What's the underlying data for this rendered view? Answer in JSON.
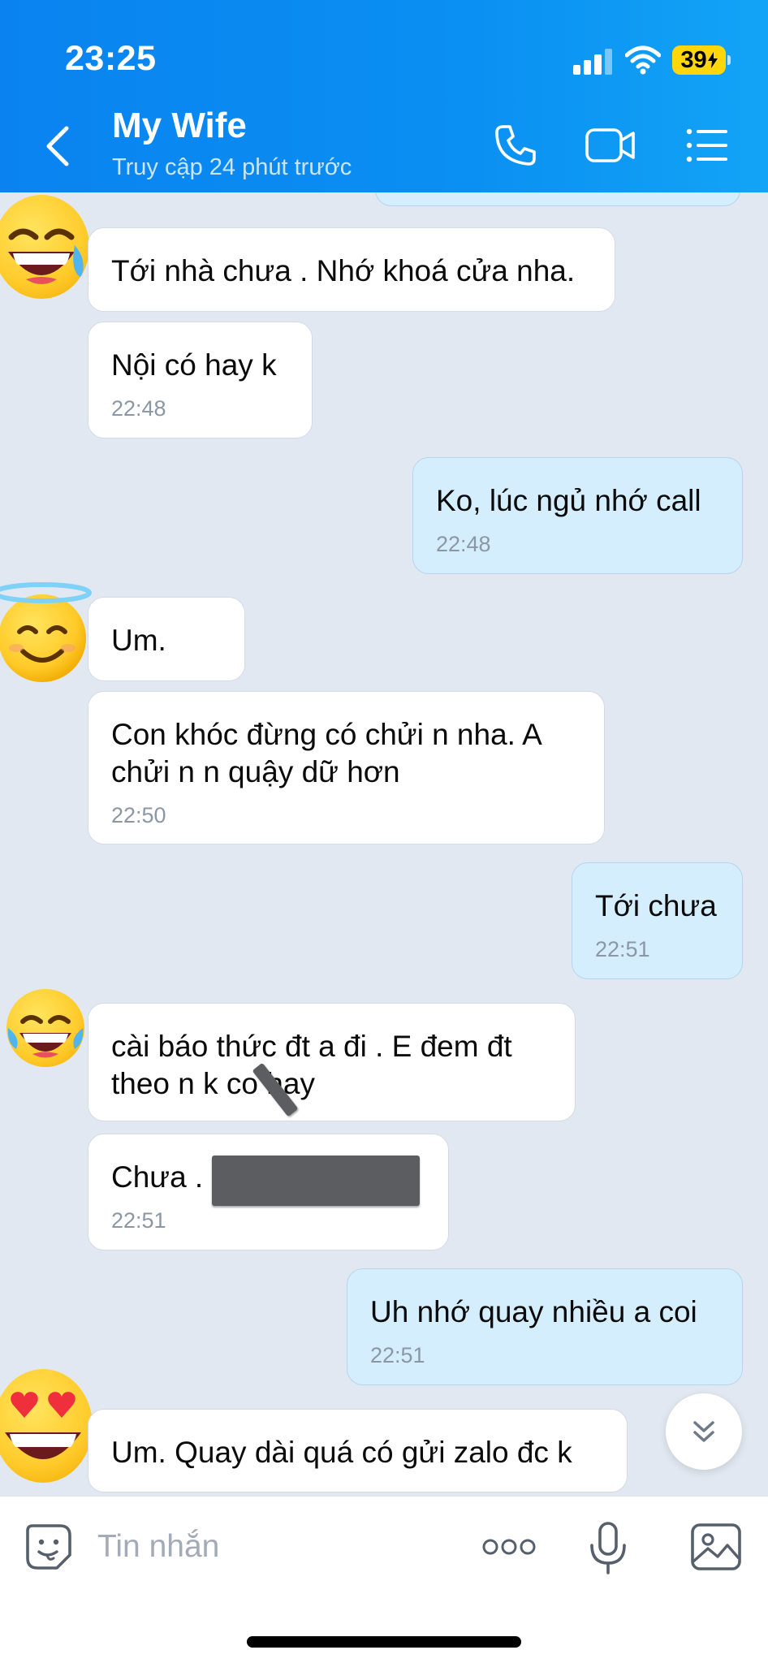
{
  "status_bar": {
    "time": "23:25",
    "battery": "39"
  },
  "header": {
    "title": "My Wife",
    "subtitle": "Truy cập 24 phút trước"
  },
  "messages": [
    {
      "direction": "in",
      "text": "Tới nhà chưa . Nhớ khoá cửa nha.",
      "time": "",
      "avatar": "face-with-tears-of-joy-emoji"
    },
    {
      "direction": "in",
      "text": "Nội có hay k",
      "time": "22:48"
    },
    {
      "direction": "out",
      "text": "Ko, lúc ngủ nhớ call",
      "time": "22:48"
    },
    {
      "direction": "in",
      "text": "Um.",
      "time": "",
      "avatar": "smiling-face-with-halo-emoji"
    },
    {
      "direction": "in",
      "line1": "Con khóc đừng có chửi n nha. A",
      "line2": "chửi n n quậy dữ hơn",
      "time": "22:50"
    },
    {
      "direction": "out",
      "text": "Tới chưa",
      "time": "22:51"
    },
    {
      "direction": "in",
      "line1": "cài báo thức đt a đi . E đem đt",
      "line2": "theo   n k co hay",
      "time": "",
      "avatar": "face-with-tears-of-joy-emoji"
    },
    {
      "direction": "in",
      "text": "Chưa .",
      "time": "22:51"
    },
    {
      "direction": "out",
      "text": "Uh nhớ quay nhiều a coi",
      "time": "22:51"
    },
    {
      "direction": "in",
      "text": "Um. Quay dài quá có gửi zalo đc k",
      "time": "",
      "avatar": "smiling-face-with-heart-eyes-emoji"
    }
  ],
  "input": {
    "placeholder": "Tin nhắn"
  },
  "colors": {
    "header": "#0a8ff2",
    "incoming_bubble": "#ffffff",
    "outgoing_bubble": "#d5eefe",
    "background": "#e2e8f1"
  }
}
